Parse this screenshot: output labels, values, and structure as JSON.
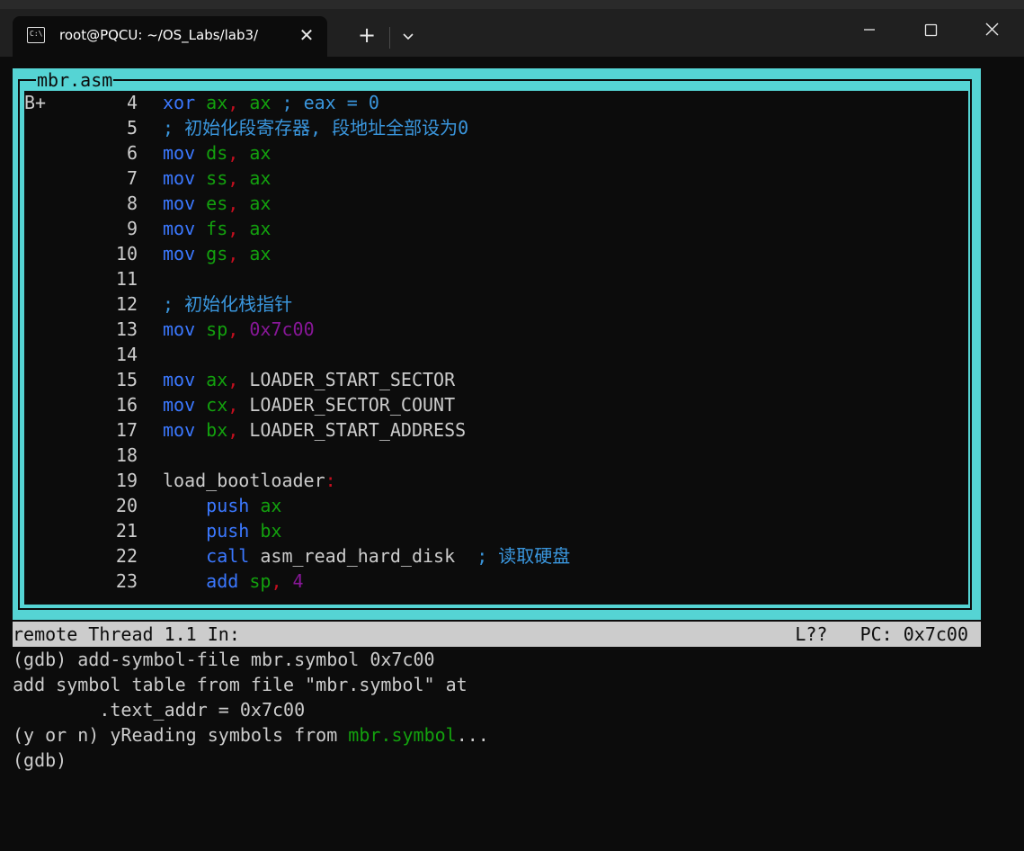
{
  "window": {
    "tab_title": "root@PQCU: ~/OS_Labs/lab3/",
    "tab_icon": "terminal-icon",
    "new_tab": "+",
    "dropdown": "⌄",
    "close_tab": "✕"
  },
  "source": {
    "title": "mbr.asm",
    "lines": [
      {
        "marker": "B+",
        "num": "4",
        "parts": [
          [
            "kw",
            "xor"
          ],
          [
            "txt",
            " "
          ],
          [
            "reg",
            "ax"
          ],
          [
            "pun",
            ","
          ],
          [
            "txt",
            " "
          ],
          [
            "reg",
            "ax"
          ],
          [
            "txt",
            " "
          ],
          [
            "cmt",
            "; eax = 0"
          ]
        ]
      },
      {
        "marker": "",
        "num": "5",
        "parts": [
          [
            "cmt",
            "; 初始化段寄存器, 段地址全部设为0"
          ]
        ]
      },
      {
        "marker": "",
        "num": "6",
        "parts": [
          [
            "kw",
            "mov"
          ],
          [
            "txt",
            " "
          ],
          [
            "reg",
            "ds"
          ],
          [
            "pun",
            ","
          ],
          [
            "txt",
            " "
          ],
          [
            "reg",
            "ax"
          ]
        ]
      },
      {
        "marker": "",
        "num": "7",
        "parts": [
          [
            "kw",
            "mov"
          ],
          [
            "txt",
            " "
          ],
          [
            "reg",
            "ss"
          ],
          [
            "pun",
            ","
          ],
          [
            "txt",
            " "
          ],
          [
            "reg",
            "ax"
          ]
        ]
      },
      {
        "marker": "",
        "num": "8",
        "parts": [
          [
            "kw",
            "mov"
          ],
          [
            "txt",
            " "
          ],
          [
            "reg",
            "es"
          ],
          [
            "pun",
            ","
          ],
          [
            "txt",
            " "
          ],
          [
            "reg",
            "ax"
          ]
        ]
      },
      {
        "marker": "",
        "num": "9",
        "parts": [
          [
            "kw",
            "mov"
          ],
          [
            "txt",
            " "
          ],
          [
            "reg",
            "fs"
          ],
          [
            "pun",
            ","
          ],
          [
            "txt",
            " "
          ],
          [
            "reg",
            "ax"
          ]
        ]
      },
      {
        "marker": "",
        "num": "10",
        "parts": [
          [
            "kw",
            "mov"
          ],
          [
            "txt",
            " "
          ],
          [
            "reg",
            "gs"
          ],
          [
            "pun",
            ","
          ],
          [
            "txt",
            " "
          ],
          [
            "reg",
            "ax"
          ]
        ]
      },
      {
        "marker": "",
        "num": "11",
        "parts": []
      },
      {
        "marker": "",
        "num": "12",
        "parts": [
          [
            "cmt",
            "; 初始化栈指针"
          ]
        ]
      },
      {
        "marker": "",
        "num": "13",
        "parts": [
          [
            "kw",
            "mov"
          ],
          [
            "txt",
            " "
          ],
          [
            "reg",
            "sp"
          ],
          [
            "pun",
            ","
          ],
          [
            "txt",
            " "
          ],
          [
            "num",
            "0x7c00"
          ]
        ]
      },
      {
        "marker": "",
        "num": "14",
        "parts": []
      },
      {
        "marker": "",
        "num": "15",
        "parts": [
          [
            "kw",
            "mov"
          ],
          [
            "txt",
            " "
          ],
          [
            "reg",
            "ax"
          ],
          [
            "pun",
            ","
          ],
          [
            "txt",
            " LOADER_START_SECTOR"
          ]
        ]
      },
      {
        "marker": "",
        "num": "16",
        "parts": [
          [
            "kw",
            "mov"
          ],
          [
            "txt",
            " "
          ],
          [
            "reg",
            "cx"
          ],
          [
            "pun",
            ","
          ],
          [
            "txt",
            " LOADER_SECTOR_COUNT"
          ]
        ]
      },
      {
        "marker": "",
        "num": "17",
        "parts": [
          [
            "kw",
            "mov"
          ],
          [
            "txt",
            " "
          ],
          [
            "reg",
            "bx"
          ],
          [
            "pun",
            ","
          ],
          [
            "txt",
            " LOADER_START_ADDRESS"
          ]
        ]
      },
      {
        "marker": "",
        "num": "18",
        "parts": []
      },
      {
        "marker": "",
        "num": "19",
        "parts": [
          [
            "txt",
            "load_bootloader"
          ],
          [
            "pun",
            ":"
          ]
        ]
      },
      {
        "marker": "",
        "num": "20",
        "parts": [
          [
            "txt",
            "    "
          ],
          [
            "kw",
            "push"
          ],
          [
            "txt",
            " "
          ],
          [
            "reg",
            "ax"
          ]
        ]
      },
      {
        "marker": "",
        "num": "21",
        "parts": [
          [
            "txt",
            "    "
          ],
          [
            "kw",
            "push"
          ],
          [
            "txt",
            " "
          ],
          [
            "reg",
            "bx"
          ]
        ]
      },
      {
        "marker": "",
        "num": "22",
        "parts": [
          [
            "txt",
            "    "
          ],
          [
            "kw",
            "call"
          ],
          [
            "txt",
            " asm_read_hard_disk  "
          ],
          [
            "cmt",
            "; 读取硬盘"
          ]
        ]
      },
      {
        "marker": "",
        "num": "23",
        "parts": [
          [
            "txt",
            "    "
          ],
          [
            "kw",
            "add"
          ],
          [
            "txt",
            " "
          ],
          [
            "reg",
            "sp"
          ],
          [
            "pun",
            ","
          ],
          [
            "txt",
            " "
          ],
          [
            "num",
            "4"
          ]
        ]
      }
    ]
  },
  "status": {
    "left": "remote Thread 1.1 In:",
    "right": "L??   PC: 0x7c00"
  },
  "console": {
    "line1": "(gdb) add-symbol-file mbr.symbol 0x7c00",
    "line2": "add symbol table from file \"mbr.symbol\" at",
    "line3": "        .text_addr = 0x7c00",
    "line4_pre": "(y or n) yReading symbols from ",
    "line4_file": "mbr.symbol",
    "line4_post": "...",
    "line5": "(gdb)"
  },
  "colors": {
    "keyword": "#3b78ff",
    "register": "#13a10e",
    "punct": "#c50f1f",
    "number": "#881798",
    "comment": "#3a96dd",
    "frame": "#55d4d4"
  }
}
